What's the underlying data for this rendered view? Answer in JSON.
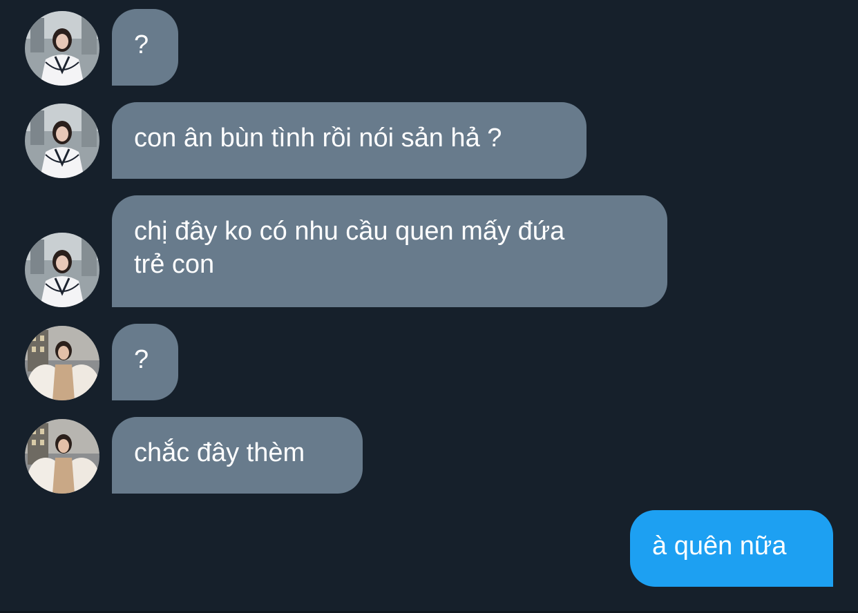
{
  "conversation": {
    "messages": [
      {
        "sender": "contact-a",
        "direction": "incoming",
        "text": "?"
      },
      {
        "sender": "contact-a",
        "direction": "incoming",
        "text": "con ân bùn tình rồi nói sản hả ?"
      },
      {
        "sender": "contact-a",
        "direction": "incoming",
        "text": "chị đây ko có nhu cầu quen mấy đứa\ntrẻ con"
      },
      {
        "sender": "contact-b",
        "direction": "incoming",
        "text": "?"
      },
      {
        "sender": "contact-b",
        "direction": "incoming",
        "text": "chắc đây thèm"
      },
      {
        "sender": "me",
        "direction": "outgoing",
        "text": "à quên nữa"
      }
    ]
  },
  "colors": {
    "background": "#16202b",
    "incoming_bubble": "#687b8c",
    "outgoing_bubble": "#1da0f2",
    "text": "#ffffff"
  }
}
